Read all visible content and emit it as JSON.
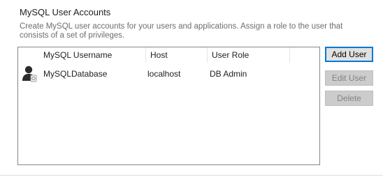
{
  "section": {
    "title": "MySQL User Accounts",
    "description": "Create MySQL user accounts for your users and applications. Assign a role to the user that consists of a set of privileges."
  },
  "table": {
    "columns": [
      "MySQL Username",
      "Host",
      "User Role"
    ],
    "rows": [
      {
        "icon": "user-silhouette-icon",
        "username": "MySQLDatabase",
        "host": "localhost",
        "role": "DB Admin"
      }
    ]
  },
  "buttons": {
    "add_user": "Add User",
    "edit_user": "Edit User",
    "delete": "Delete"
  },
  "colors": {
    "accent": "#0078d7",
    "disabled_bg": "#cccccc",
    "disabled_text": "#838383",
    "description_text": "#6d6d6d"
  }
}
